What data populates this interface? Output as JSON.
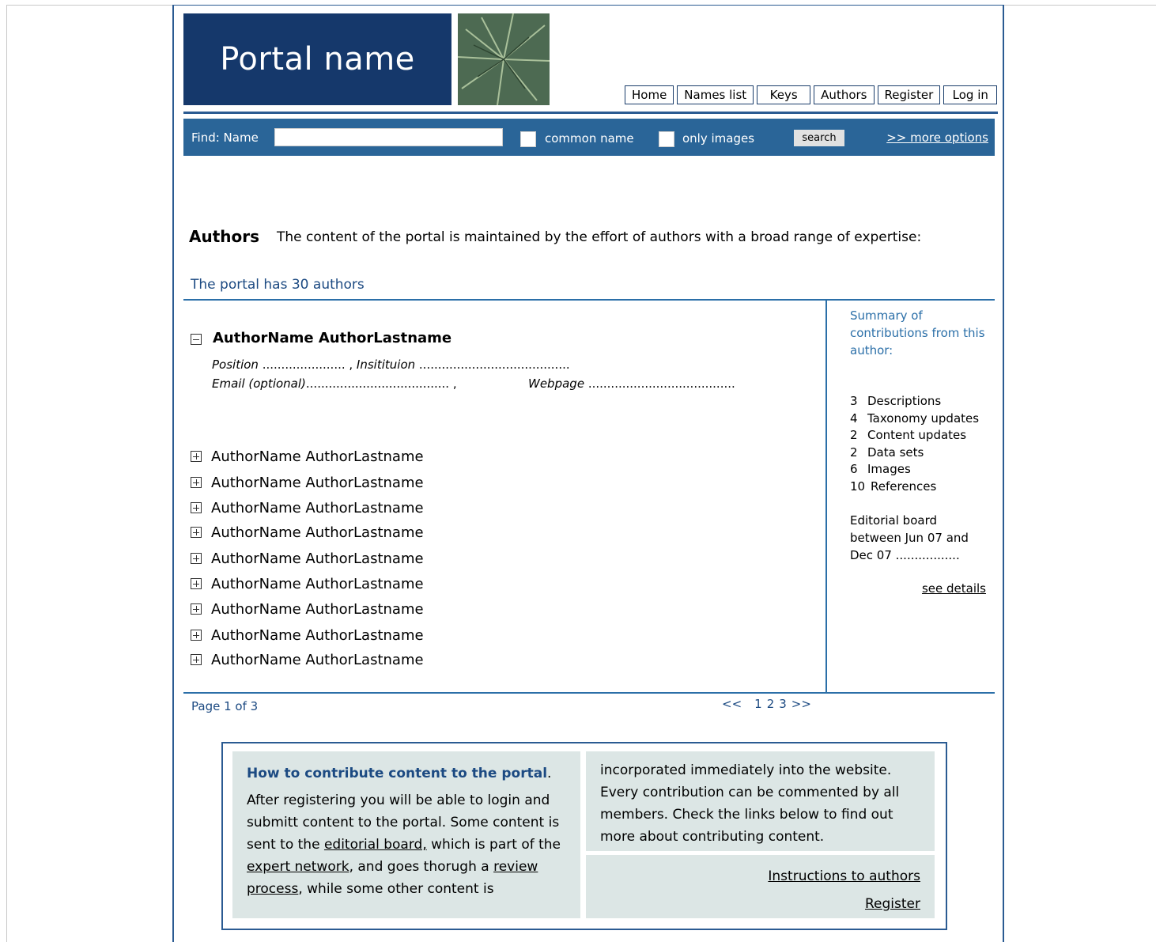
{
  "header": {
    "portal_name": "Portal name",
    "nav": [
      "Home",
      "Names list",
      "Keys",
      "Authors",
      "Register",
      "Log in"
    ]
  },
  "search": {
    "find_label": "Find:  Name",
    "name_value": "",
    "common_name_label": "common name",
    "only_images_label": "only images",
    "search_button": "search",
    "more_options": ">> more options"
  },
  "intro": {
    "heading": "Authors",
    "description": "The content of the portal is maintained by the effort of authors with a broad range of expertise:",
    "count_text": "The portal has 30 authors"
  },
  "expanded_author": {
    "name": "AuthorName AuthorLastname",
    "position_label": "Position",
    "position_dots": " ...................... ,",
    "institution_label": " Insitituion",
    "institution_dots": " ........................................",
    "email_label": "Email (optional)",
    "email_dots": "...................................... ,",
    "webpage_label": "Webpage",
    "webpage_dots": " .......................................",
    "icon": "collapse-minus-icon"
  },
  "authors": [
    "AuthorName AuthorLastname",
    "AuthorName AuthorLastname",
    "AuthorName AuthorLastname",
    "AuthorName AuthorLastname",
    "AuthorName AuthorLastname",
    "AuthorName AuthorLastname",
    "AuthorName AuthorLastname",
    "AuthorName AuthorLastname",
    "AuthorName AuthorLastname"
  ],
  "summary": {
    "title": "Summary of contributions from this author:",
    "stats": [
      {
        "num": "3",
        "label": "Descriptions"
      },
      {
        "num": "4",
        "label": "Taxonomy updates"
      },
      {
        "num": "2",
        "label": "Content updates"
      },
      {
        "num": "2",
        "label": "Data sets"
      },
      {
        "num": "6",
        "label": "Images"
      },
      {
        "num": "10",
        "label": "References"
      }
    ],
    "board": "Editorial board between Jun 07 and Dec 07 .................",
    "see_details": "see details"
  },
  "pager": {
    "info": "Page 1 of 3",
    "prev": "<<",
    "pages": [
      "1",
      "2",
      "3"
    ],
    "next": ">>"
  },
  "contribute": {
    "title": "How to contribute content to the portal",
    "title_period": ".",
    "text1": "After registering you will be able to login and submitt content to the portal. Some content is sent to the ",
    "link_editorial": "editorial board,",
    "text2": " which is part of the ",
    "link_expert": "expert network",
    "text3": ", and goes thorugh a ",
    "link_review": "review process",
    "text4": ", while some other content is",
    "right_text": "incorporated immediately into the website. Every contribution can be commented by all members. Check the links below to find out more about contributing content.",
    "link_instructions": "Instructions to authors",
    "link_register": "Register"
  },
  "colors": {
    "brand_dark": "#15386b",
    "search_bar": "#2a6598",
    "accent": "#2b6fa8",
    "panel": "#dce6e5"
  }
}
